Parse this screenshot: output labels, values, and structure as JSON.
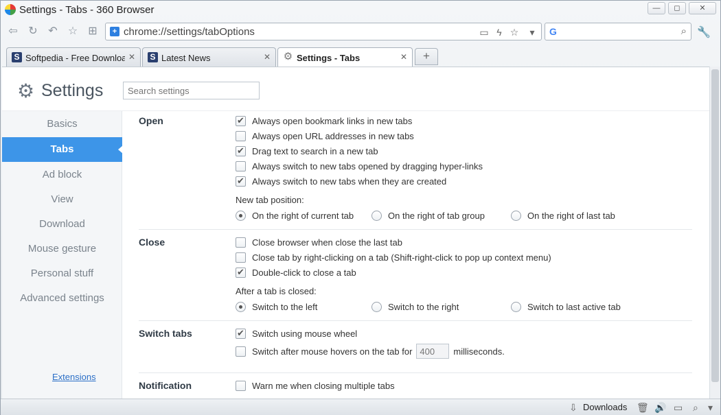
{
  "window": {
    "title": "Settings - Tabs - 360 Browser",
    "minimize": "—",
    "maximize": "◻",
    "close": "✕"
  },
  "toolbar": {
    "url": "chrome://settings/tabOptions"
  },
  "tabs": [
    {
      "label": "Softpedia - Free Downloa",
      "favicon": "S"
    },
    {
      "label": "Latest News",
      "favicon": "S"
    },
    {
      "label": "Settings - Tabs",
      "favicon": "⚙"
    }
  ],
  "new_tab_label": "+",
  "settings": {
    "title": "Settings",
    "search_placeholder": "Search settings"
  },
  "sidebar": {
    "items": [
      {
        "label": "Basics"
      },
      {
        "label": "Tabs"
      },
      {
        "label": "Ad block"
      },
      {
        "label": "View"
      },
      {
        "label": "Download"
      },
      {
        "label": "Mouse gesture"
      },
      {
        "label": "Personal stuff"
      },
      {
        "label": "Advanced settings"
      }
    ],
    "extensions": "Extensions"
  },
  "sections": {
    "open": {
      "label": "Open",
      "options": [
        {
          "label": "Always open bookmark links in new tabs",
          "checked": true
        },
        {
          "label": "Always open URL addresses in new tabs",
          "checked": false
        },
        {
          "label": "Drag text to search in a new tab",
          "checked": true
        },
        {
          "label": "Always switch to new tabs opened by dragging hyper-links",
          "checked": false
        },
        {
          "label": "Always switch to new tabs when they are created",
          "checked": true
        }
      ],
      "position_label": "New tab position:",
      "positions": [
        {
          "label": "On the right of current tab",
          "selected": true
        },
        {
          "label": "On the right of tab group",
          "selected": false
        },
        {
          "label": "On the right of last tab",
          "selected": false
        }
      ]
    },
    "close": {
      "label": "Close",
      "options": [
        {
          "label": "Close browser when close the last tab",
          "checked": false
        },
        {
          "label": "Close tab by right-clicking on a tab (Shift-right-click to pop up context menu)",
          "checked": false
        },
        {
          "label": "Double-click to close a tab",
          "checked": true
        }
      ],
      "after_label": "After a tab is closed:",
      "after": [
        {
          "label": "Switch to the left",
          "selected": true
        },
        {
          "label": "Switch to the right",
          "selected": false
        },
        {
          "label": "Switch to last active tab",
          "selected": false
        }
      ]
    },
    "switch": {
      "label": "Switch tabs",
      "wheel": {
        "label": "Switch using mouse wheel",
        "checked": true
      },
      "hover_prefix": "Switch after mouse hovers on the tab for",
      "hover_value": "400",
      "hover_suffix": "milliseconds.",
      "hover_checked": false
    },
    "notification": {
      "label": "Notification",
      "warn": {
        "label": "Warn me when closing multiple tabs",
        "checked": false
      }
    }
  },
  "statusbar": {
    "downloads": "Downloads"
  },
  "colors": {
    "accent": "#3d95e8",
    "link": "#2b6fc7"
  }
}
